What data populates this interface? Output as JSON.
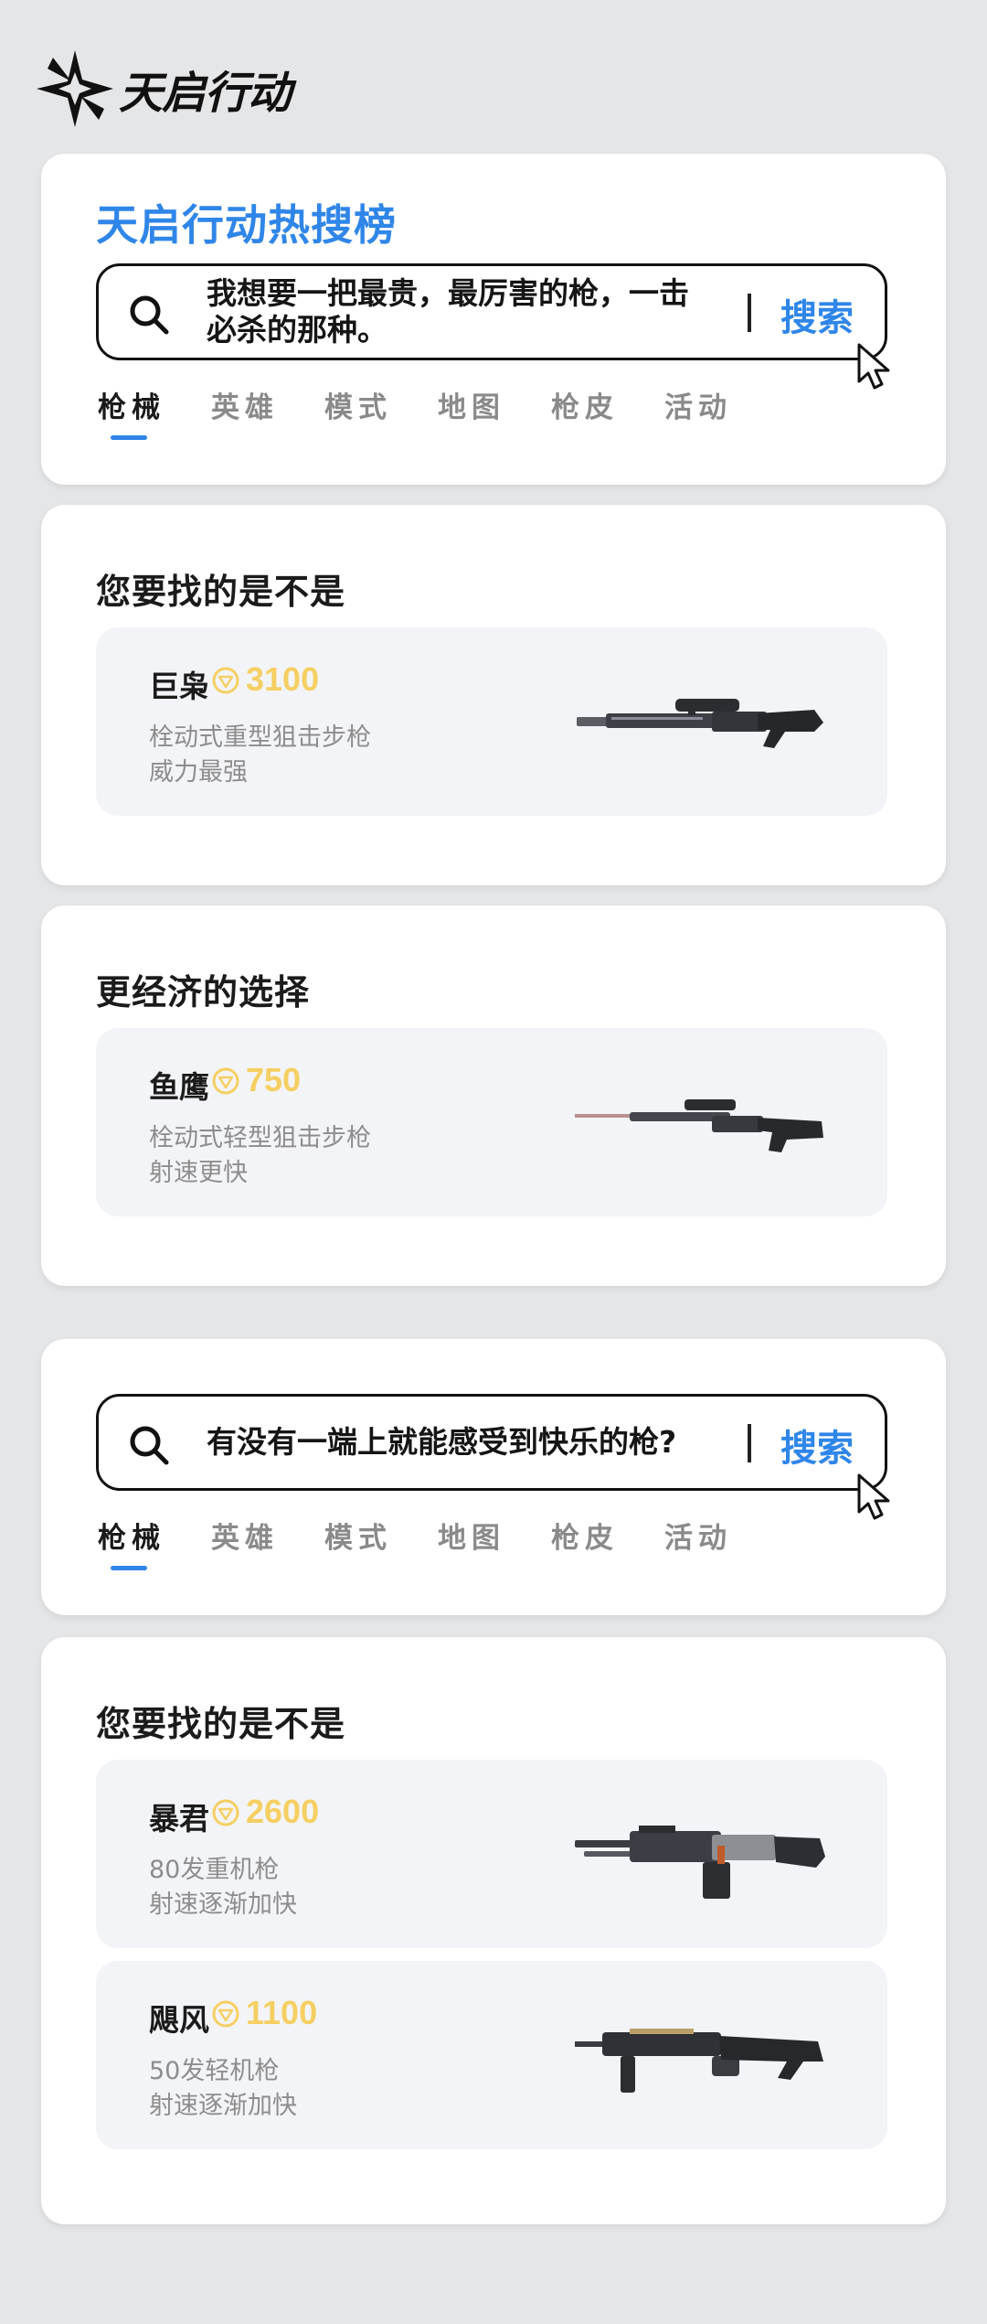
{
  "logo": {
    "text": "天启行动"
  },
  "panel1": {
    "title": "天启行动热搜榜",
    "query": "我想要一把最贵，最厉害的枪，一击必杀的那种。",
    "search_label": "搜索",
    "tabs": [
      "枪械",
      "英雄",
      "模式",
      "地图",
      "枪皮",
      "活动"
    ],
    "active_tab": "枪械"
  },
  "result1": {
    "title": "您要找的是不是",
    "items": [
      {
        "name": "巨枭",
        "price": "3100",
        "desc1": "栓动式重型狙击步枪",
        "desc2": "威力最强",
        "icon": "sniper-rifle-heavy"
      }
    ]
  },
  "result2": {
    "title": "更经济的选择",
    "items": [
      {
        "name": "鱼鹰",
        "price": "750",
        "desc1": "栓动式轻型狙击步枪",
        "desc2": "射速更快",
        "icon": "sniper-rifle-light"
      }
    ]
  },
  "panel2": {
    "query": "有没有一端上就能感受到快乐的枪?",
    "search_label": "搜索",
    "tabs": [
      "枪械",
      "英雄",
      "模式",
      "地图",
      "枪皮",
      "活动"
    ],
    "active_tab": "枪械"
  },
  "result3": {
    "title": "您要找的是不是",
    "items": [
      {
        "name": "暴君",
        "price": "2600",
        "desc1": "80发重机枪",
        "desc2": "射速逐渐加快",
        "icon": "heavy-machine-gun"
      },
      {
        "name": "飓风",
        "price": "1100",
        "desc1": "50发轻机枪",
        "desc2": "射速逐渐加快",
        "icon": "light-machine-gun"
      }
    ]
  },
  "colors": {
    "accent": "#2f86e8",
    "coin": "#f5cf62",
    "background": "#e5e6e8",
    "item_bg": "#f3f4f7"
  }
}
